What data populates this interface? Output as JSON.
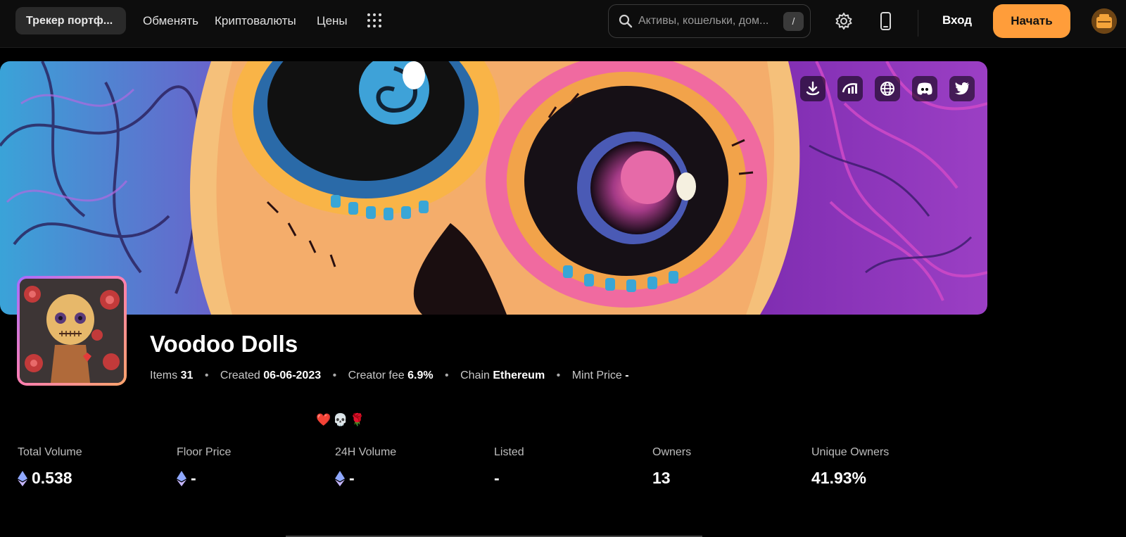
{
  "nav": {
    "tracker_label": "Трекер портф...",
    "links": [
      "Обменять",
      "Криптовалюты",
      "Цены"
    ],
    "search_placeholder": "Активы, кошельки, дом...",
    "search_shortcut": "/",
    "login_label": "Вход",
    "start_label": "Начать"
  },
  "collection": {
    "name": "Voodoo Dolls",
    "items_label": "Items",
    "items_value": "31",
    "created_label": "Created",
    "created_value": "06-06-2023",
    "fee_label": "Creator fee",
    "fee_value": "6.9%",
    "chain_label": "Chain",
    "chain_value": "Ethereum",
    "mint_label": "Mint Price",
    "mint_value": "-",
    "emojis": "❤️💀🌹"
  },
  "stats": [
    {
      "label": "Total Volume",
      "value": "0.538",
      "eth": true
    },
    {
      "label": "Floor Price",
      "value": "-",
      "eth": true
    },
    {
      "label": "24H Volume",
      "value": "-",
      "eth": true
    },
    {
      "label": "Listed",
      "value": "-",
      "eth": false
    },
    {
      "label": "Owners",
      "value": "13",
      "eth": false
    },
    {
      "label": "Unique Owners",
      "value": "41.93%",
      "eth": false
    }
  ],
  "socials": [
    "opensea-like-icon",
    "looksrare-like-icon",
    "globe-icon",
    "discord-icon",
    "twitter-icon"
  ],
  "colors": {
    "accent": "#ff9d3a",
    "background": "#000000",
    "topbar": "#0d0d0d"
  }
}
